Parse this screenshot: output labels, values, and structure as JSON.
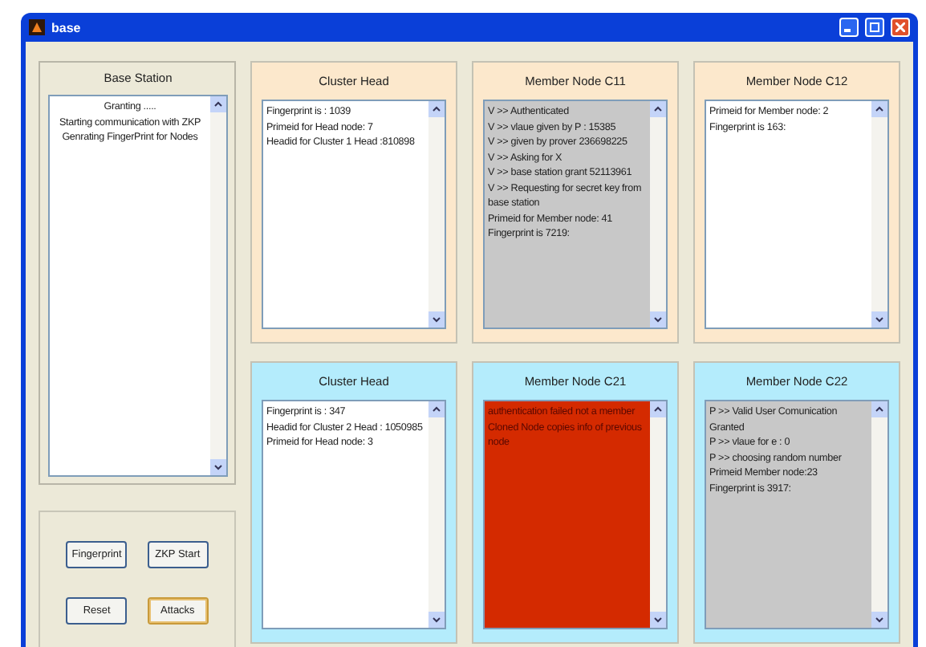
{
  "window": {
    "title": "base"
  },
  "base_station": {
    "title": "Base Station",
    "lines": [
      "Granting .....",
      "Starting communication with ZKP",
      "Genrating FingerPrint for Nodes"
    ]
  },
  "buttons": [
    {
      "label": "Fingerprint",
      "focused": false
    },
    {
      "label": "ZKP Start",
      "focused": false
    },
    {
      "label": "Reset",
      "focused": false
    },
    {
      "label": "Attacks",
      "focused": true
    }
  ],
  "clusters": [
    {
      "color": "#fce8cc",
      "nodes": [
        {
          "title": "Cluster Head",
          "color": "#ffffff",
          "lines": [
            "Fingerprint is : 1039",
            "Primeid for Head node: 7",
            "Headid for Cluster 1 Head :810898"
          ]
        },
        {
          "title": "Member Node C11",
          "color": "#c8c8c8",
          "lines": [
            "V >> Authenticated",
            "V >> vlaue given by P : 15385",
            "V >> given by prover 236698225",
            "V >> Asking for X",
            "V >> base station grant 52113961",
            "V >> Requesting for secret key from base station",
            "Primeid for Member node: 41",
            "Fingerprint is 7219:"
          ]
        },
        {
          "title": "Member Node C12",
          "color": "#ffffff",
          "lines": [
            "Primeid for Member node: 2",
            "Fingerprint is 163:"
          ]
        }
      ]
    },
    {
      "color": "#b4ecfc",
      "nodes": [
        {
          "title": "Cluster Head",
          "color": "#ffffff",
          "lines": [
            "Fingerprint is : 347",
            "Headid for Cluster 2 Head : 1050985",
            "Primeid for Head node: 3"
          ]
        },
        {
          "title": "Member Node C21",
          "color": "#d42a00",
          "lines": [
            "authentication failed not a member",
            "Cloned Node copies info of previous node"
          ]
        },
        {
          "title": "Member Node C22",
          "color": "#c8c8c8",
          "lines": [
            "P >> Valid User Comunication Granted",
            "P >> vlaue for e : 0",
            "P >> choosing random number",
            "Primeid Member node:23",
            "Fingerprint is 3917:"
          ]
        }
      ]
    }
  ]
}
